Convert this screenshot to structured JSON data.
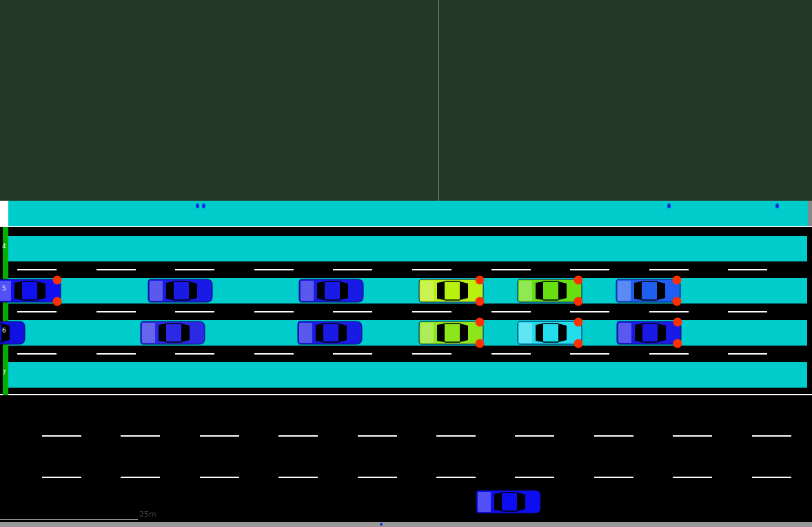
{
  "scene": {
    "scale_label": "25m"
  },
  "lanes": [
    {
      "label": "4",
      "cars": []
    },
    {
      "label": "5",
      "cars": [
        {
          "color": "#1010f0",
          "blinker": true
        },
        {
          "color": "#1a1ae6",
          "blinker": false
        },
        {
          "color": "#1a1ae6",
          "blinker": false
        },
        {
          "color": "#b8f010",
          "blinker": true
        },
        {
          "color": "#66e010",
          "blinker": true
        },
        {
          "color": "#1e5ef0",
          "blinker": true
        }
      ]
    },
    {
      "label": "6",
      "cars": [
        {
          "color": "#1010e0",
          "blinker": false
        },
        {
          "color": "#2a2ae6",
          "blinker": false
        },
        {
          "color": "#1a1ae6",
          "blinker": false
        },
        {
          "color": "#8ce61a",
          "blinker": true
        },
        {
          "color": "#22ddee",
          "blinker": true
        },
        {
          "color": "#1a1ae6",
          "blinker": true
        }
      ]
    },
    {
      "label": "7",
      "cars": []
    }
  ],
  "lower_road": {
    "cars": [
      {
        "color": "#0d0df0",
        "blinker": false
      }
    ]
  }
}
